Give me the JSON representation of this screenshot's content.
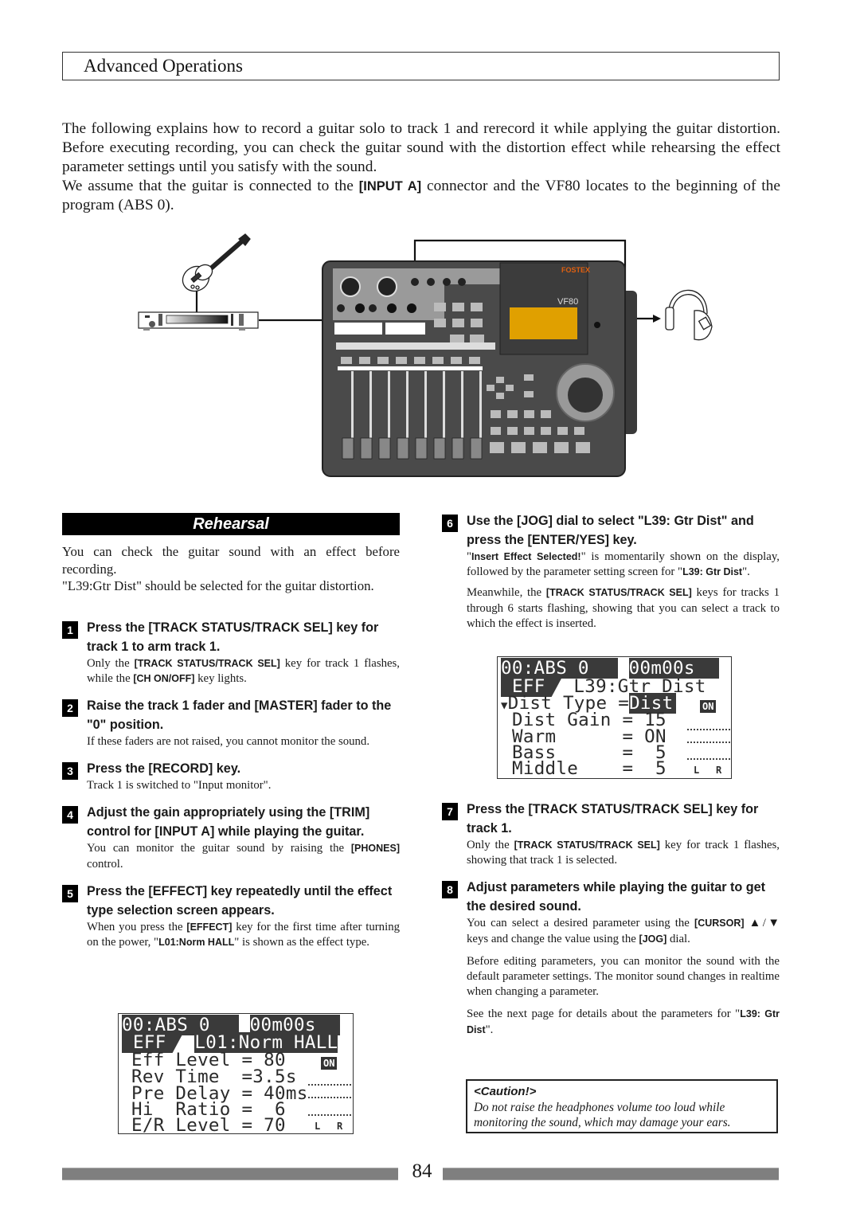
{
  "header": {
    "title": "Advanced Operations"
  },
  "intro": {
    "p1": "The following explains how to record a guitar solo to track 1 and rerecord it while applying the guitar distortion. Before executing recording, you can check the guitar sound with the distortion effect while rehearsing the effect parameter settings until you satisfy with the sound.",
    "p2_before": "We assume that the guitar is connected to the ",
    "p2_key": "[INPUT A]",
    "p2_after": " connector and the VF80 locates to the beginning of the program (ABS 0)."
  },
  "illustration": {
    "device_brand": "FOSTEX",
    "device_model": "VF80",
    "lcd_color": "#e0a000",
    "brand_color": "#e06010",
    "panel_color": "#4a4a4a",
    "items": [
      "guitar-icon",
      "effect-processor-icon",
      "multitrack-recorder-icon",
      "headphones-icon"
    ]
  },
  "section": {
    "title": "Rehearsal",
    "intro1": "You can check the guitar sound with an effect before recording.",
    "intro2": "\"L39:Gtr Dist\" should be selected for the guitar distortion."
  },
  "steps": [
    {
      "num": "1",
      "title": "Press the [TRACK STATUS/TRACK SEL] key for track 1 to arm track 1.",
      "body": [
        {
          "t": "Only the "
        },
        {
          "k": "[TRACK STATUS/TRACK SEL]"
        },
        {
          "t": " key for track 1 flashes, while the "
        },
        {
          "k": "[CH ON/OFF]"
        },
        {
          "t": " key lights."
        }
      ]
    },
    {
      "num": "2",
      "title": "Raise the track 1 fader and [MASTER] fader to the \"0\" position.",
      "body": [
        {
          "t": "If these faders are not raised, you cannot monitor the sound."
        }
      ]
    },
    {
      "num": "3",
      "title": "Press the [RECORD] key.",
      "body": [
        {
          "t": "Track 1 is switched to \"Input monitor\"."
        }
      ]
    },
    {
      "num": "4",
      "title": "Adjust the gain appropriately using the [TRIM] control for [INPUT A] while playing the guitar.",
      "body": [
        {
          "t": "You can monitor the guitar sound by raising the "
        },
        {
          "k": "[PHONES]"
        },
        {
          "t": " control."
        }
      ]
    },
    {
      "num": "5",
      "title": "Press the [EFFECT] key repeatedly until the effect type selection screen appears.",
      "body": [
        {
          "t": "When you press the "
        },
        {
          "k": "[EFFECT]"
        },
        {
          "t": " key for the first time after turning on the power, \""
        },
        {
          "k": "L01:Norm HALL"
        },
        {
          "t": "\" is shown as the effect type."
        }
      ]
    },
    {
      "num": "6",
      "title": "Use the [JOG] dial to select \"L39: Gtr Dist\" and press the [ENTER/YES] key.",
      "body": [
        {
          "t": "\""
        },
        {
          "k": "Insert Effect Selected!"
        },
        {
          "t": "\" is momentarily shown on the display, followed by the parameter setting screen for \""
        },
        {
          "k": "L39: Gtr Dist"
        },
        {
          "t": "\"."
        }
      ],
      "body2": [
        {
          "t": "Meanwhile, the "
        },
        {
          "k": "[TRACK STATUS/TRACK SEL]"
        },
        {
          "t": " keys for tracks 1 through 6 starts flashing, showing that you can select a track to which the effect is inserted."
        }
      ]
    },
    {
      "num": "7",
      "title": "Press the [TRACK STATUS/TRACK SEL] key for track 1.",
      "body": [
        {
          "t": "Only the "
        },
        {
          "k": "[TRACK STATUS/TRACK SEL]"
        },
        {
          "t": " key for track 1 flashes, showing that track 1 is selected."
        }
      ]
    },
    {
      "num": "8",
      "title": "Adjust parameters while playing the guitar to get the desired sound.",
      "body": [
        {
          "t": "You can select a desired parameter using the "
        },
        {
          "k": "[CURSOR]"
        },
        {
          "t": " ▲/▼ keys and change the value using the "
        },
        {
          "k": "[JOG]"
        },
        {
          "t": " dial."
        }
      ],
      "body2": [
        {
          "t": "Before editing parameters, you can monitor the sound with the default parameter settings. The monitor sound changes in realtime when changing a parameter."
        }
      ],
      "body3": [
        {
          "t": "See the next page for details about the parameters for \""
        },
        {
          "k": "L39: Gtr Dist"
        },
        {
          "t": "\"."
        }
      ]
    }
  ],
  "lcd1": {
    "locate": "00:ABS 0",
    "time": "00m00s",
    "eff": "EFF",
    "effect_name": "L01:Norm HALL",
    "on_badge": "ON",
    "rows": [
      "Eff Level = 80",
      "Rev Time  =3.5s",
      "Pre Delay = 40ms",
      "Hi  Ratio =  6",
      "E/R Level = 70"
    ],
    "meter_l": "L",
    "meter_r": "R"
  },
  "lcd2": {
    "locate": "00:ABS 0",
    "time": "00m00s",
    "eff": "EFF",
    "effect_name": "L39:Gtr Dist",
    "on_badge": "ON",
    "cursor": "▼",
    "rows": [
      {
        "label": "Dist Type ",
        "eq": "=",
        "value": "Dist",
        "selected": true
      },
      {
        "label": "Dist Gain ",
        "eq": "=",
        "value": " 15"
      },
      {
        "label": "Warm      ",
        "eq": "=",
        "value": " ON"
      },
      {
        "label": "Bass      ",
        "eq": "=",
        "value": "  5"
      },
      {
        "label": "Middle    ",
        "eq": "=",
        "value": "  5"
      }
    ],
    "meter_l": "L",
    "meter_r": "R"
  },
  "caution": {
    "title": "<Caution!>",
    "body": "Do not raise the headphones volume too loud while monitoring the sound, which may damage your ears."
  },
  "footer": {
    "page_number": "84"
  }
}
